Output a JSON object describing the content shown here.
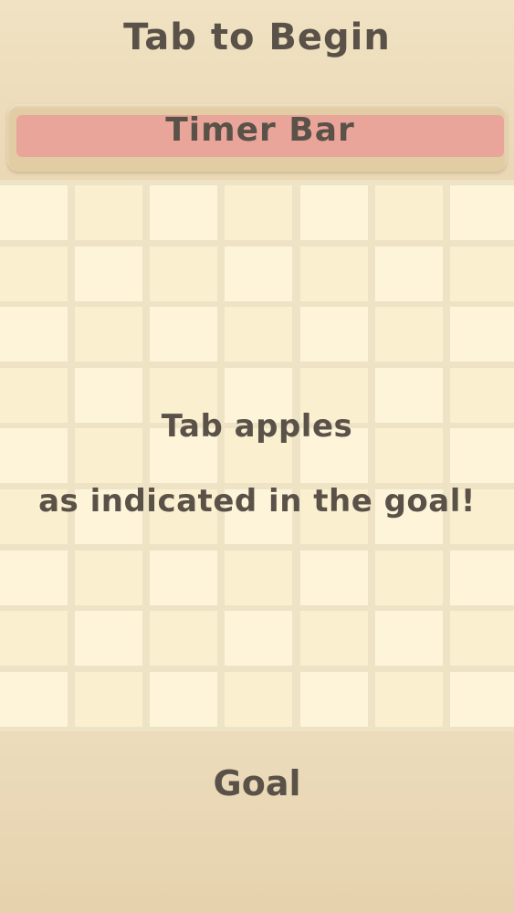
{
  "header": {
    "title": "Tab to Begin",
    "timer_label": "Timer Bar"
  },
  "board": {
    "columns": 7,
    "rows": 9,
    "instruction_line1": "Tab apples",
    "instruction_line2": "as indicated in the goal!"
  },
  "footer": {
    "goal_label": "Goal"
  },
  "colors": {
    "background": "#ecdcbc",
    "timer_bar": "#eaa59a",
    "cell_light": "#fdf4da",
    "cell_dark": "#faefcf",
    "text": "#5a5248"
  }
}
